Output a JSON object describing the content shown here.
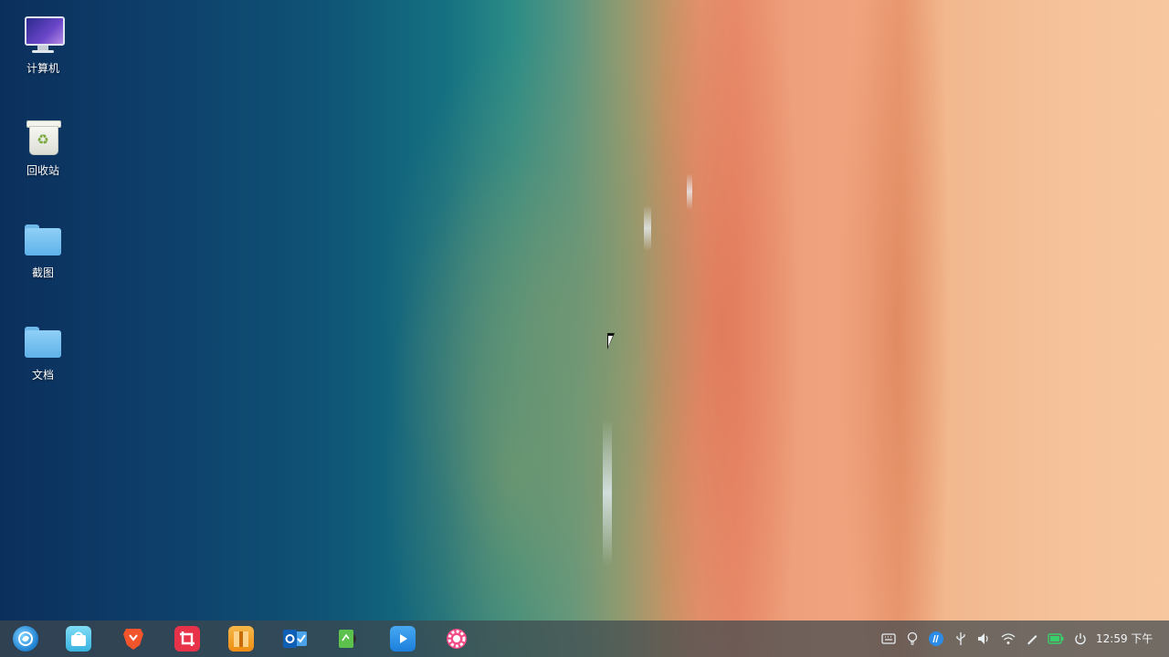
{
  "desktop_icons": [
    {
      "label": "计算机",
      "icon": "computer-icon"
    },
    {
      "label": "回收站",
      "icon": "trash-icon"
    },
    {
      "label": "截图",
      "icon": "folder-icon"
    },
    {
      "label": "文档",
      "icon": "folder-icon"
    }
  ],
  "dock_apps": [
    {
      "icon": "launcher-icon",
      "color": "#1d7fd0"
    },
    {
      "icon": "app-store-icon",
      "color": "#4fc3e8"
    },
    {
      "icon": "brave-browser-icon",
      "color": "#f2552c"
    },
    {
      "icon": "screenshot-crop-icon",
      "color": "#e8324a"
    },
    {
      "icon": "archive-manager-icon",
      "color": "#f39a1e"
    },
    {
      "icon": "outlook-mail-icon",
      "color": "#1a73c9"
    },
    {
      "icon": "document-viewer-icon",
      "color": "#4cb848"
    },
    {
      "icon": "video-player-icon",
      "color": "#2f8ee5"
    },
    {
      "icon": "settings-gear-icon",
      "color": "#e84a7a"
    }
  ],
  "tray_icons": [
    "keyboard-icon",
    "lightbulb-icon",
    "hp-printer-icon",
    "usb-icon",
    "volume-icon",
    "wifi-icon",
    "pen-icon",
    "battery-icon",
    "power-icon"
  ],
  "clock": {
    "time": "12:59 下午"
  }
}
